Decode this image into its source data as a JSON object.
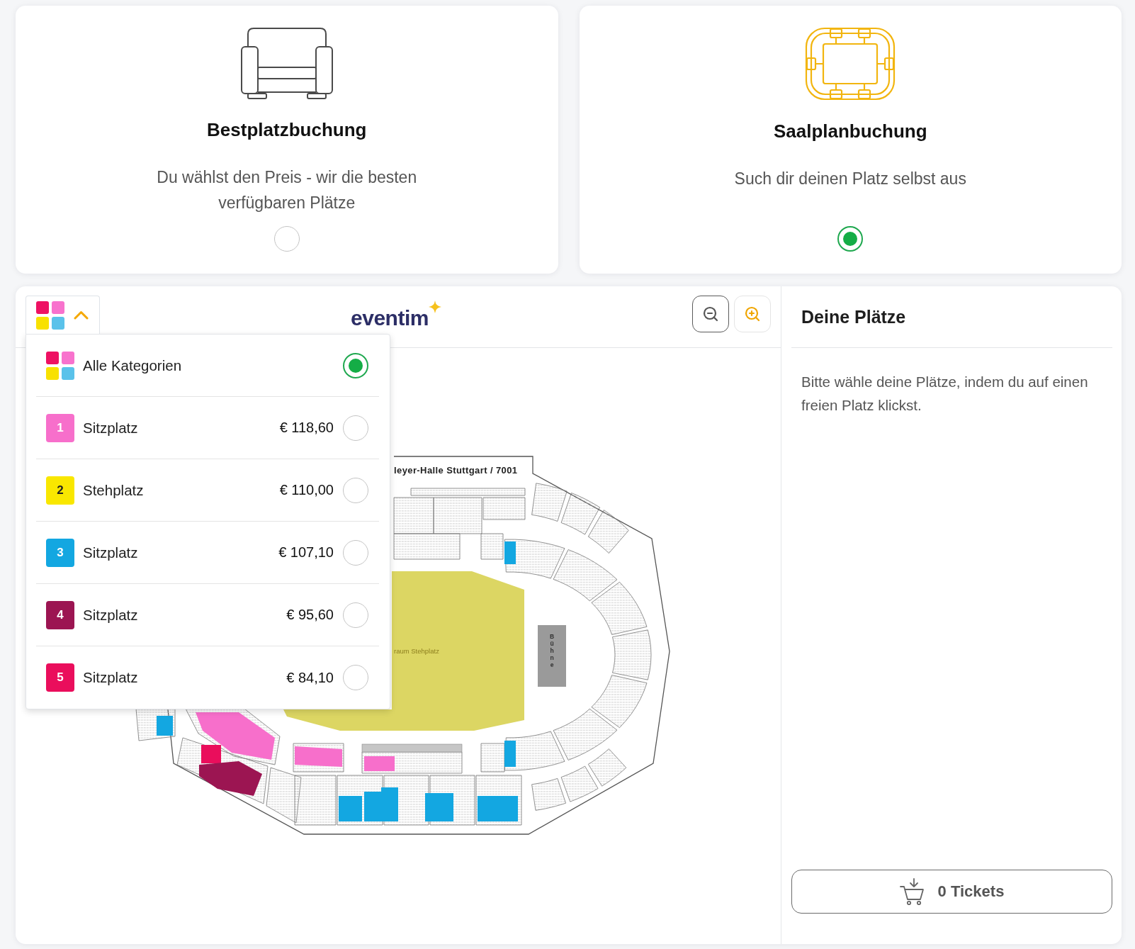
{
  "booking_modes": [
    {
      "kind": "best_seat",
      "title": "Bestplatzbuchung",
      "description": "Du wählst den Preis - wir die besten verfügbaren Plätze",
      "selected": false
    },
    {
      "kind": "seat_plan",
      "title": "Saalplanbuchung",
      "description": "Such dir deinen Platz selbst aus",
      "selected": true
    }
  ],
  "logo": "eventim",
  "category_menu": {
    "expanded": true,
    "options": [
      {
        "kind": "all",
        "label": "Alle Kategorien",
        "selected": true
      },
      {
        "kind": "category",
        "number": "1",
        "label": "Sitzplatz",
        "price": "€ 118,60",
        "color": "#f76fcb",
        "selected": false
      },
      {
        "kind": "category",
        "number": "2",
        "label": "Stehplatz",
        "price": "€ 110,00",
        "color": "#f9e700",
        "selected": false
      },
      {
        "kind": "category",
        "number": "3",
        "label": "Sitzplatz",
        "price": "€ 107,10",
        "color": "#13a7e1",
        "selected": false
      },
      {
        "kind": "category",
        "number": "4",
        "label": "Sitzplatz",
        "price": "€ 95,60",
        "color": "#9c1552",
        "selected": false
      },
      {
        "kind": "category",
        "number": "5",
        "label": "Sitzplatz",
        "price": "€ 84,10",
        "color": "#ea0e5c",
        "selected": false
      }
    ]
  },
  "seat_map": {
    "title": "leyer-Halle Stuttgart / 7001",
    "standing_area_label": "raum Stehplatz",
    "stage_label": "Bühne"
  },
  "selection_panel": {
    "title": "Deine Plätze",
    "hint": "Bitte wähle deine Plätze, indem du auf einen freien Platz klickst.",
    "cart_button": "0 Tickets"
  }
}
